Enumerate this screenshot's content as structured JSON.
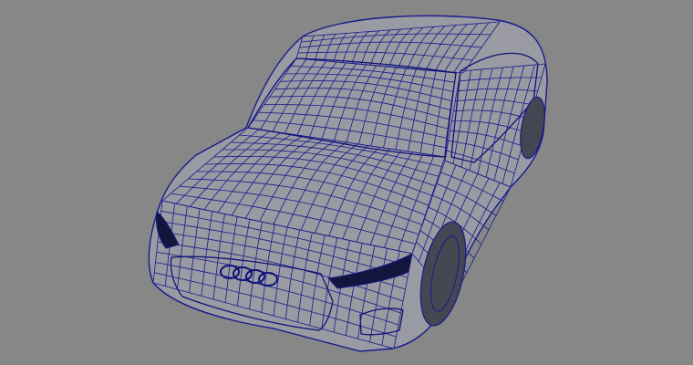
{
  "viewport": {
    "background_color": "#878787",
    "wire_color": "#171a8c",
    "dark_fill_color": "#12163c",
    "shading_color": "#9a9aa2"
  },
  "model": {
    "display_mode": "wireframe-on-shaded",
    "subject": "sedan car",
    "visible_text": []
  }
}
